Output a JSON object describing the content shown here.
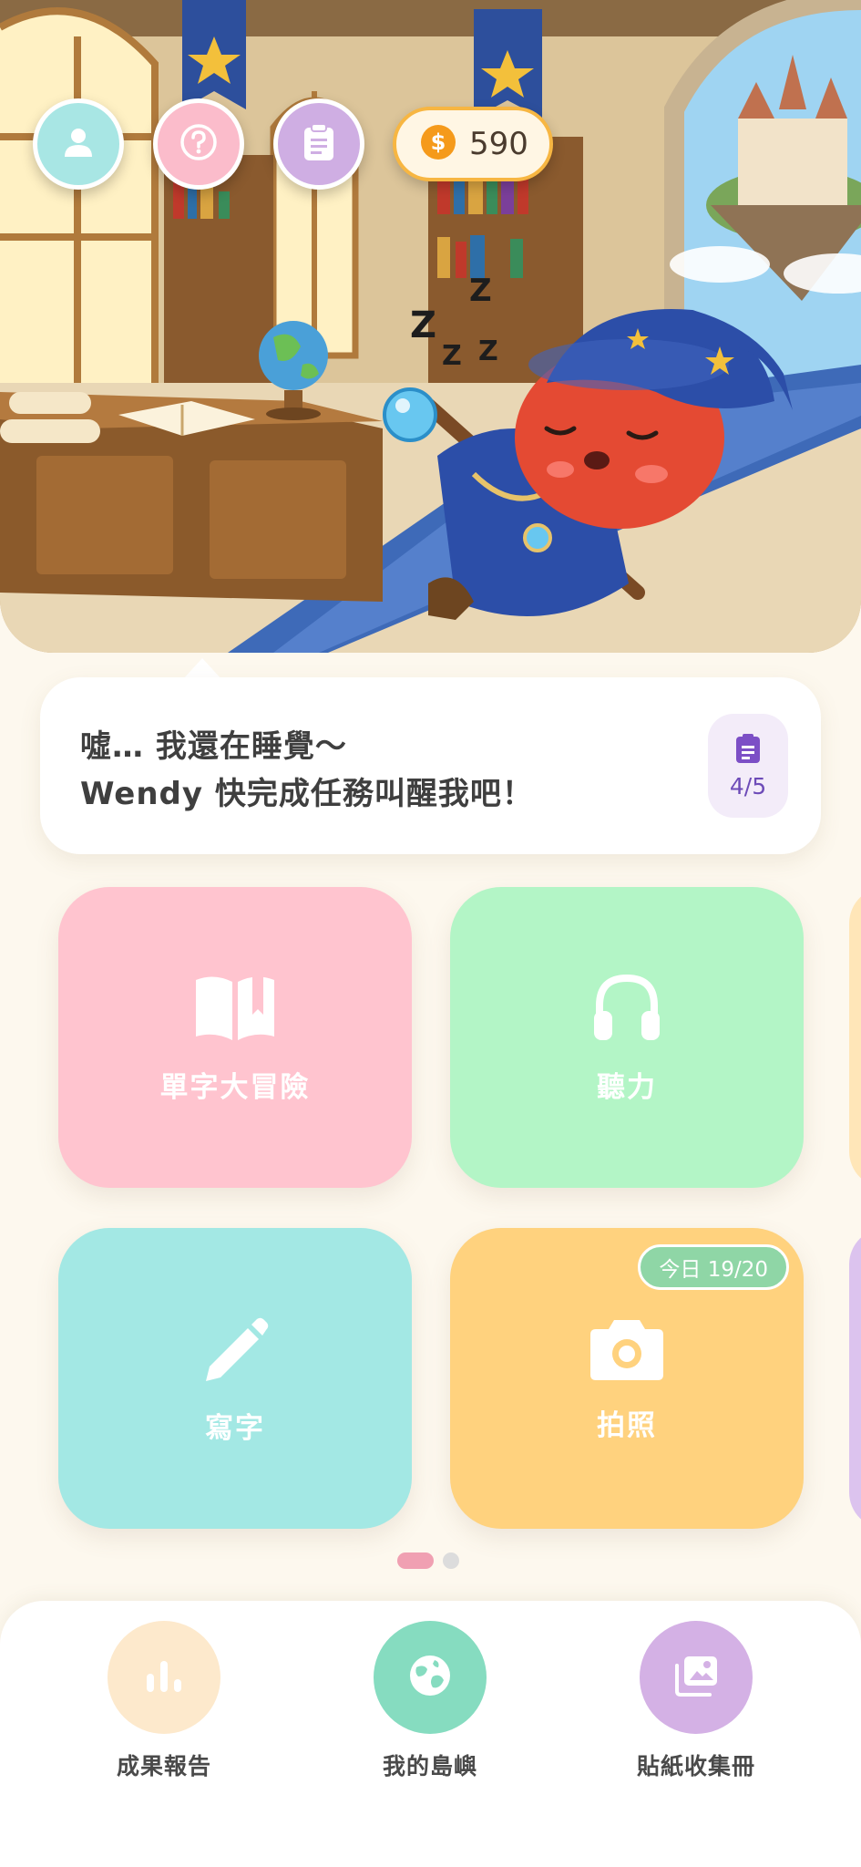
{
  "header": {
    "profile_icon": "person-icon",
    "help_icon": "question-circle-icon",
    "tasks_icon": "clipboard-icon",
    "coins": {
      "icon": "dollar-coin-icon",
      "value": "590"
    }
  },
  "speech": {
    "line1": "噓… 我還在睡覺～",
    "line2": "Wendy 快完成任務叫醒我吧！",
    "task_progress": "4/5"
  },
  "tiles": [
    {
      "label": "單字大冒險",
      "icon": "open-book-icon",
      "color": "#ffc4cf"
    },
    {
      "label": "聽力",
      "icon": "headphones-icon",
      "color": "#b3f5c6"
    },
    {
      "label": "寫字",
      "icon": "pencil-icon",
      "color": "#a3e8e4"
    },
    {
      "label": "拍照",
      "icon": "camera-icon",
      "color": "#ffd27e",
      "badge": "今日 19/20"
    }
  ],
  "pagination": {
    "current": 1,
    "total": 2
  },
  "bottom_nav": [
    {
      "label": "成果報告",
      "icon": "bar-chart-icon",
      "color": "#fde9cc"
    },
    {
      "label": "我的島嶼",
      "icon": "globe-icon",
      "color": "#86dcc0"
    },
    {
      "label": "貼紙收集冊",
      "icon": "photo-album-icon",
      "color": "#d4b1e5"
    }
  ]
}
